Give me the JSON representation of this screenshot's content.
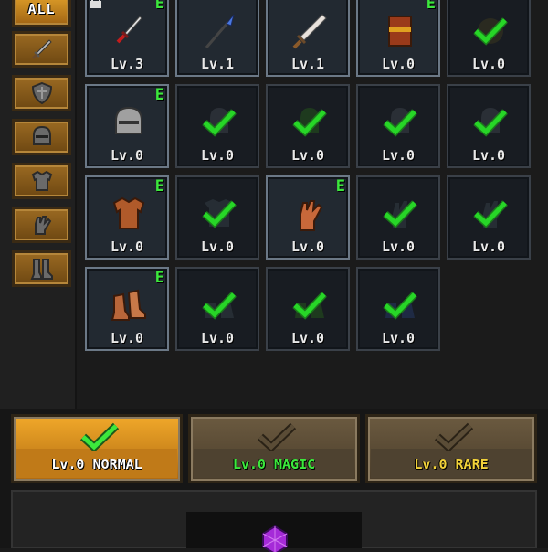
{
  "sidebar": {
    "all_label": "ALL",
    "categories": [
      {
        "name": "all",
        "icon": "all"
      },
      {
        "name": "weapon",
        "icon": "sword-icon"
      },
      {
        "name": "shield",
        "icon": "shield-icon"
      },
      {
        "name": "helmet",
        "icon": "helmet-icon"
      },
      {
        "name": "armor",
        "icon": "armor-icon"
      },
      {
        "name": "gloves",
        "icon": "gloves-icon"
      },
      {
        "name": "boots",
        "icon": "boots-icon"
      }
    ]
  },
  "grid": {
    "rows": [
      [
        {
          "level": "Lv.3",
          "equipped": "E",
          "locked": true,
          "owned": true,
          "item": "red-dagger"
        },
        {
          "level": "Lv.1",
          "equipped": "",
          "locked": false,
          "owned": true,
          "item": "blue-spear"
        },
        {
          "level": "Lv.1",
          "equipped": "",
          "locked": false,
          "owned": true,
          "item": "broad-sword"
        },
        {
          "level": "Lv.0",
          "equipped": "E",
          "locked": false,
          "owned": true,
          "item": "wooden-shield"
        },
        {
          "level": "Lv.0",
          "equipped": "",
          "locked": false,
          "owned": false,
          "item": "round-shield"
        }
      ],
      [
        {
          "level": "Lv.0",
          "equipped": "E",
          "locked": false,
          "owned": true,
          "item": "iron-helmet"
        },
        {
          "level": "Lv.0",
          "equipped": "",
          "locked": false,
          "owned": false,
          "item": "helmet"
        },
        {
          "level": "Lv.0",
          "equipped": "",
          "locked": false,
          "owned": false,
          "item": "helmet"
        },
        {
          "level": "Lv.0",
          "equipped": "",
          "locked": false,
          "owned": false,
          "item": "helmet"
        },
        {
          "level": "Lv.0",
          "equipped": "",
          "locked": false,
          "owned": false,
          "item": "helmet"
        }
      ],
      [
        {
          "level": "Lv.0",
          "equipped": "E",
          "locked": false,
          "owned": true,
          "item": "leather-armor"
        },
        {
          "level": "Lv.0",
          "equipped": "",
          "locked": false,
          "owned": false,
          "item": "armor"
        },
        {
          "level": "Lv.0",
          "equipped": "E",
          "locked": false,
          "owned": true,
          "item": "leather-gloves"
        },
        {
          "level": "Lv.0",
          "equipped": "",
          "locked": false,
          "owned": false,
          "item": "gloves"
        },
        {
          "level": "Lv.0",
          "equipped": "",
          "locked": false,
          "owned": false,
          "item": "gloves"
        }
      ],
      [
        {
          "level": "Lv.0",
          "equipped": "E",
          "locked": false,
          "owned": true,
          "item": "leather-boots"
        },
        {
          "level": "Lv.0",
          "equipped": "",
          "locked": false,
          "owned": false,
          "item": "boots"
        },
        {
          "level": "Lv.0",
          "equipped": "",
          "locked": false,
          "owned": false,
          "item": "boots"
        },
        {
          "level": "Lv.0",
          "equipped": "",
          "locked": false,
          "owned": false,
          "item": "boots"
        }
      ]
    ]
  },
  "tiers": [
    {
      "label": "Lv.0 NORMAL",
      "color": "#ffffff",
      "selected": true
    },
    {
      "label": "Lv.0 MAGIC",
      "color": "#3ce83c",
      "selected": false
    },
    {
      "label": "Lv.0 RARE",
      "color": "#f2d23a",
      "selected": false
    }
  ],
  "colors": {
    "check": "#27d627",
    "equipped": "#3ce83c",
    "gem": "#a52ad8"
  }
}
